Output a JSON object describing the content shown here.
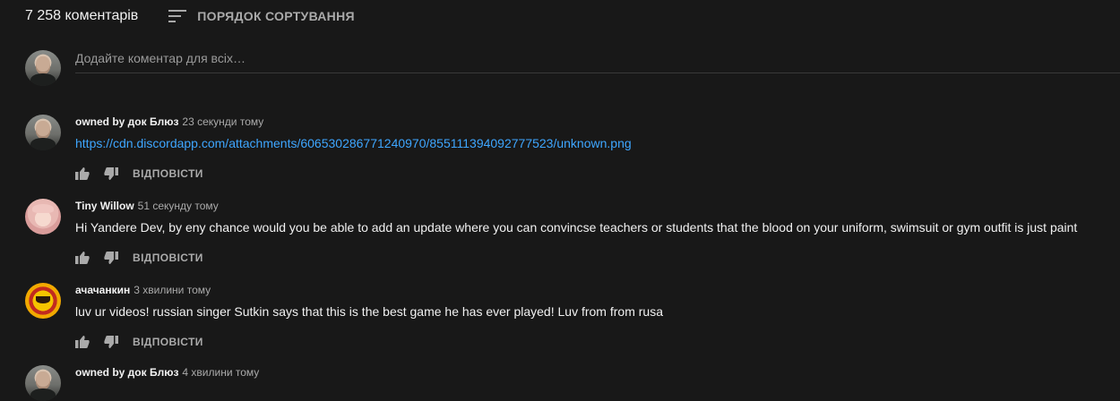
{
  "header": {
    "comment_count": "7 258 коментарів",
    "sort_label": "ПОРЯДОК СОРТУВАННЯ",
    "sort_icon": "sort-lines-icon"
  },
  "add_comment": {
    "placeholder": "Додайте коментар для всіх…"
  },
  "comments": [
    {
      "author": "owned by док Блюз",
      "time": "23 секунди тому",
      "text": "https://cdn.discordapp.com/attachments/606530286771240970/855111394092777523/unknown.png",
      "reply_label": "ВІДПОВІСТИ"
    },
    {
      "author": "Tiny Willow",
      "time": "51 секунду тому",
      "text": "Hi Yandere Dev, by eny chance would you be able to add an update where you can convincse teachers or students that the blood on your uniform, swimsuit  or gym outfit is just paint",
      "reply_label": "ВІДПОВІСТИ"
    },
    {
      "author": "ачачанкин",
      "time": "3 хвилини тому",
      "text": "luv ur videos! russian singer Sutkin says that this is the best game he has ever played! Luv from from rusa",
      "reply_label": "ВІДПОВІСТИ"
    },
    {
      "author": "owned by док Блюз",
      "time": "4 хвилини тому"
    }
  ],
  "colors": {
    "background": "#181818",
    "text": "#f1f1f1",
    "secondary": "#aaaaaa",
    "link": "#3ea6ff"
  }
}
